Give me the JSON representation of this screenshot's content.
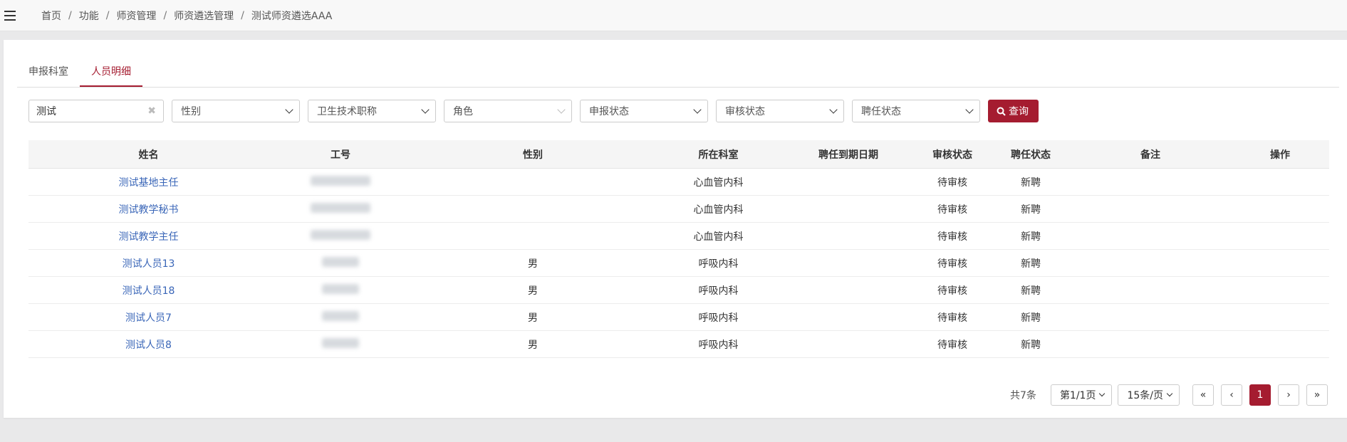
{
  "breadcrumb": [
    "首页",
    "功能",
    "师资管理",
    "师资遴选管理",
    "测试师资遴选AAA"
  ],
  "tabs": [
    {
      "label": "申报科室",
      "active": false
    },
    {
      "label": "人员明细",
      "active": true
    }
  ],
  "filters": {
    "keyword": "测试",
    "gender_placeholder": "性别",
    "title_placeholder": "卫生技术职称",
    "role_placeholder": "角色",
    "apply_status_placeholder": "申报状态",
    "audit_status_placeholder": "审核状态",
    "hire_status_placeholder": "聘任状态",
    "search_label": "查询"
  },
  "table": {
    "headers": [
      "姓名",
      "工号",
      "性别",
      "所在科室",
      "聘任到期日期",
      "审核状态",
      "聘任状态",
      "备注",
      "操作"
    ],
    "rows": [
      {
        "name": "测试基地主任",
        "id": "",
        "gender": "",
        "dept": "心血管内科",
        "expiry": "",
        "audit": "待审核",
        "hire": "新聘",
        "note": "",
        "op": ""
      },
      {
        "name": "测试教学秘书",
        "id": "",
        "gender": "",
        "dept": "心血管内科",
        "expiry": "",
        "audit": "待审核",
        "hire": "新聘",
        "note": "",
        "op": ""
      },
      {
        "name": "测试教学主任",
        "id": "",
        "gender": "",
        "dept": "心血管内科",
        "expiry": "",
        "audit": "待审核",
        "hire": "新聘",
        "note": "",
        "op": ""
      },
      {
        "name": "测试人员13",
        "id": "",
        "gender": "男",
        "dept": "呼吸内科",
        "expiry": "",
        "audit": "待审核",
        "hire": "新聘",
        "note": "",
        "op": ""
      },
      {
        "name": "测试人员18",
        "id": "",
        "gender": "男",
        "dept": "呼吸内科",
        "expiry": "",
        "audit": "待审核",
        "hire": "新聘",
        "note": "",
        "op": ""
      },
      {
        "name": "测试人员7",
        "id": "",
        "gender": "男",
        "dept": "呼吸内科",
        "expiry": "",
        "audit": "待审核",
        "hire": "新聘",
        "note": "",
        "op": ""
      },
      {
        "name": "测试人员8",
        "id": "",
        "gender": "男",
        "dept": "呼吸内科",
        "expiry": "",
        "audit": "待审核",
        "hire": "新聘",
        "note": "",
        "op": ""
      }
    ]
  },
  "pagination": {
    "total": "共7条",
    "page_label": "第1/1页",
    "size_label": "15条/页",
    "first": "«",
    "prev": "‹",
    "current": "1",
    "next": "›",
    "last": "»"
  },
  "colors": {
    "accent": "#a51c30",
    "link": "#3a66b8"
  },
  "icons": {
    "menu": "hamburger-icon",
    "search": "search-icon",
    "clear": "clear-icon",
    "dropdown": "chevron-down-icon"
  }
}
